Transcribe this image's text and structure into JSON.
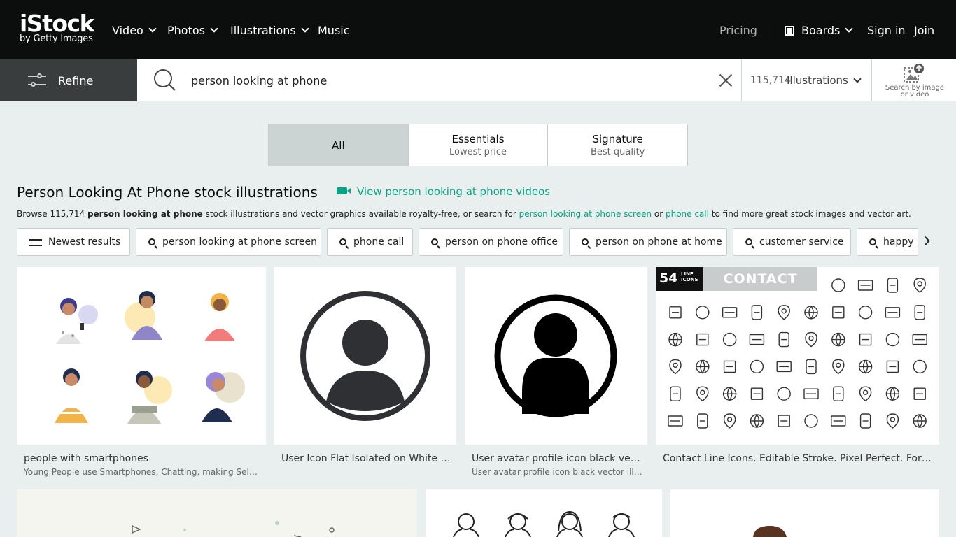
{
  "header": {
    "logo_main": "iStock",
    "logo_sub": "by Getty Images",
    "nav": [
      {
        "label": "Video",
        "dropdown": true
      },
      {
        "label": "Photos",
        "dropdown": true
      },
      {
        "label": "Illustrations",
        "dropdown": true
      },
      {
        "label": "Music",
        "dropdown": false
      }
    ],
    "pricing": "Pricing",
    "boards": "Boards",
    "sign_in": "Sign in",
    "join": "Join"
  },
  "search": {
    "refine": "Refine",
    "query": "person looking at phone",
    "count": "115,714",
    "type": "Illustrations",
    "search_by_image": "Search by image or video"
  },
  "tabs": [
    {
      "title": "All",
      "sub": ""
    },
    {
      "title": "Essentials",
      "sub": "Lowest price"
    },
    {
      "title": "Signature",
      "sub": "Best quality"
    }
  ],
  "results": {
    "heading": "Person Looking At Phone stock illustrations",
    "video_link": "View person looking at phone videos",
    "browse_prefix": "Browse 115,714 ",
    "browse_bold": "person looking at phone",
    "browse_mid": " stock illustrations and vector graphics available royalty-free, or search for ",
    "browse_link1": "person looking at phone screen",
    "browse_or": " or ",
    "browse_link2": "phone call",
    "browse_suffix": " to find more great stock images and vector art."
  },
  "chips": [
    "Newest results",
    "person looking at phone screen",
    "phone call",
    "person on phone office",
    "person on phone at home",
    "customer service",
    "happy p"
  ],
  "cards": [
    {
      "title": "people with smartphones",
      "sub": "Young People use Smartphones, Chatting, making Selfie ..."
    },
    {
      "title": "User Icon Flat Isolated on White Ba...",
      "sub": ""
    },
    {
      "title": "User avatar profile icon black vect...",
      "sub": "User avatar profile icon black vector illus..."
    },
    {
      "title": "Contact Line Icons. Editable Stroke. Pixel Perfect. For M...",
      "sub": "",
      "badge_num": "54",
      "badge_small": "LINE ICONS",
      "badge_text": "CONTACT"
    }
  ],
  "colors": {
    "accent": "#08a385",
    "topbar": "#0c0d0d",
    "refine_bg": "#3a3d3d",
    "page_bg": "#e9eeee"
  }
}
